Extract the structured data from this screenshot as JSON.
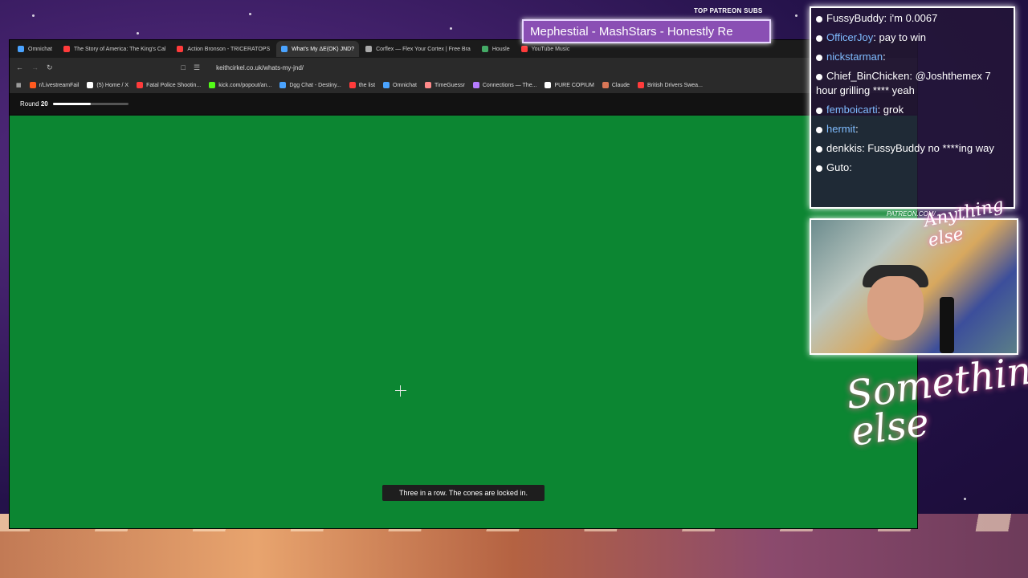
{
  "overlay": {
    "patreon_label": "TOP PATREON SUBS",
    "patreon_ticker": "Mephestial - MashStars - Honestly Re",
    "patreon_url": "PATREON.COM/",
    "logo_small": "Anything else",
    "logo_large": "Something else"
  },
  "chat": [
    {
      "user": "FussyBuddy",
      "text": ": i'm 0.0067",
      "color": "#ffffff"
    },
    {
      "user": "OfficerJoy",
      "text": ": pay to win",
      "color": "#7fbcff"
    },
    {
      "user": "nickstarman",
      "text": ":",
      "color": "#7fbcff"
    },
    {
      "user": "Chief_BinChicken",
      "text": ": @Joshthemex 7 hour grilling **** yeah",
      "color": "#ffffff"
    },
    {
      "user": "femboicarti",
      "text": ": grok",
      "color": "#7fbcff"
    },
    {
      "user": "hermit",
      "text": ":",
      "color": "#7fbcff"
    },
    {
      "user": "denkkis",
      "text": ": FussyBuddy no ****ing way",
      "color": "#ffffff"
    },
    {
      "user": "Guto",
      "text": ":",
      "color": "#ffffff"
    }
  ],
  "browser": {
    "tabs": [
      {
        "label": "Omnichat",
        "color": "#4aa3ff",
        "active": false
      },
      {
        "label": "The Story of America: The King's Cal",
        "color": "#ff3b3b",
        "active": false
      },
      {
        "label": "Action Bronson - TRICERATOPS",
        "color": "#ff3b3b",
        "active": false
      },
      {
        "label": "What's My ΔE(OK) JND?",
        "color": "#4aa3ff",
        "active": true
      },
      {
        "label": "Corflex — Flex Your Cortex | Free Bra",
        "color": "#aaaaaa",
        "active": false
      },
      {
        "label": "Housle",
        "color": "#44aa66",
        "active": false
      },
      {
        "label": "YouTube Music",
        "color": "#ff3b3b",
        "active": false
      }
    ],
    "url": "keithcirkel.co.uk/whats-my-jnd/",
    "bookmarks": [
      {
        "label": "r/LivestreamFail",
        "color": "#ff5a1f"
      },
      {
        "label": "(5) Home / X",
        "color": "#ffffff"
      },
      {
        "label": "Fatal Police Shootin...",
        "color": "#ff3b3b"
      },
      {
        "label": "kick.com/popout/an...",
        "color": "#53fc18"
      },
      {
        "label": "Dgg Chat - Destiny...",
        "color": "#4aa3ff"
      },
      {
        "label": "the list",
        "color": "#ff3b3b"
      },
      {
        "label": "Omnichat",
        "color": "#4aa3ff"
      },
      {
        "label": "TimeGuessr",
        "color": "#ff8a8a"
      },
      {
        "label": "Connections — The...",
        "color": "#b57cff"
      },
      {
        "label": "PURE COPIUM",
        "color": "#ffffff"
      },
      {
        "label": "Claude",
        "color": "#d97757"
      },
      {
        "label": "British Drivers Swea...",
        "color": "#ff3b3b"
      }
    ]
  },
  "game": {
    "round_label": "Round",
    "round_number": "20",
    "progress_fraction": 0.5,
    "toast": "Three in a row. The cones are locked in.",
    "color": "#0c8632"
  }
}
